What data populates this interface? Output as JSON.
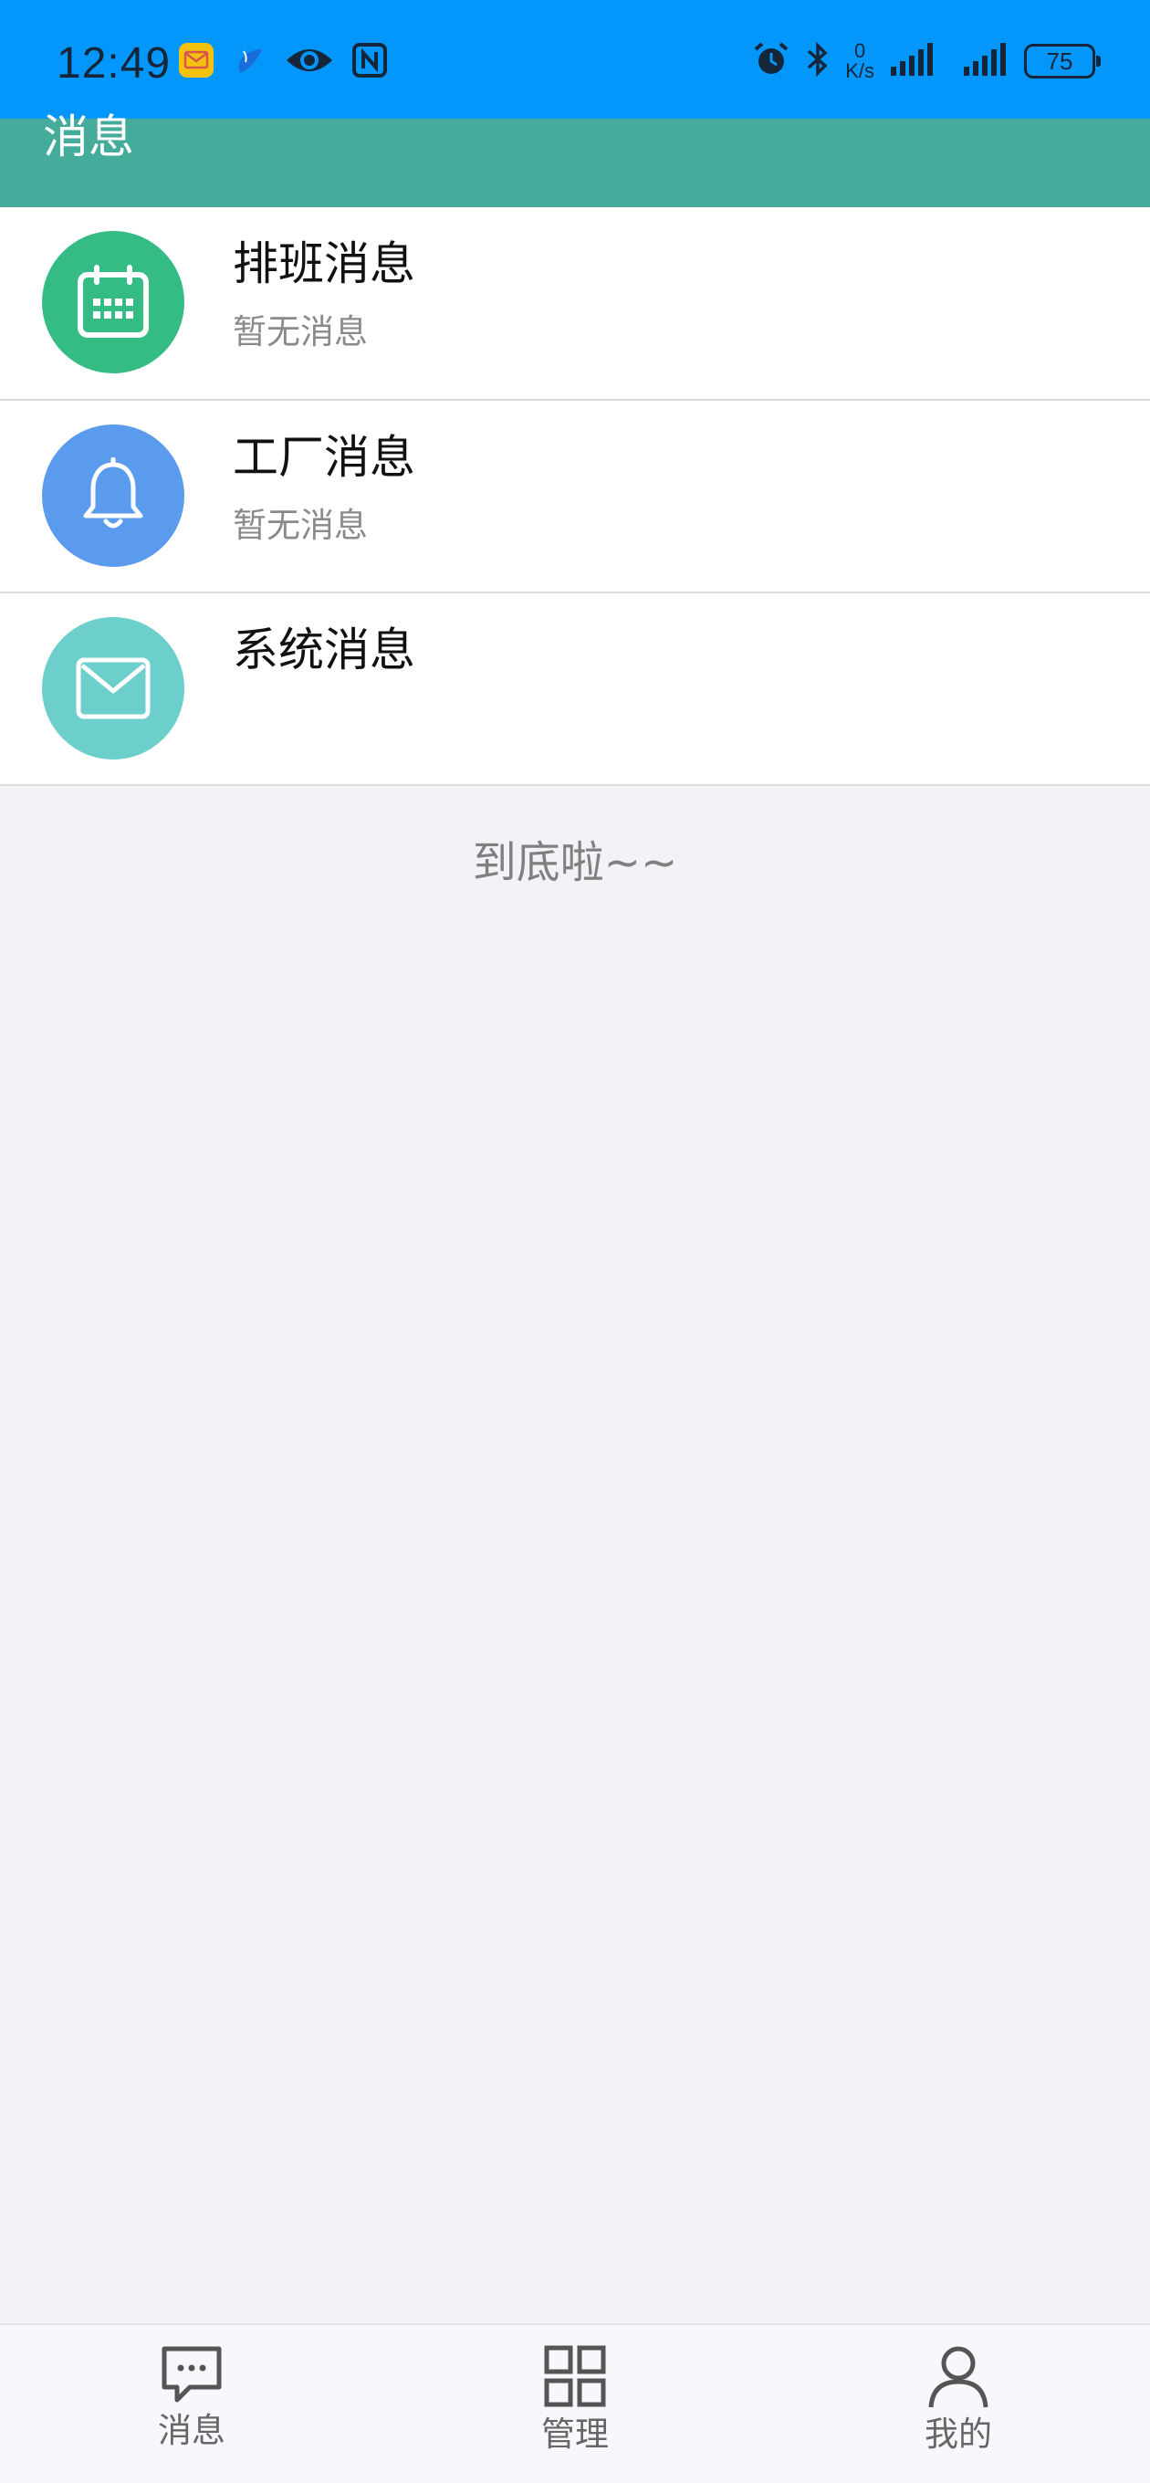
{
  "status_bar": {
    "time": "12:49",
    "net_speed_value": "0",
    "net_speed_unit": "K/s",
    "battery": "75",
    "left_icons": [
      "mail-app-icon",
      "feather-app-icon",
      "eye-icon",
      "nfc-icon"
    ],
    "right_icons": [
      "alarm-icon",
      "bluetooth-icon",
      "signal-icon",
      "signal-icon",
      "battery-icon"
    ]
  },
  "header": {
    "title": "消息"
  },
  "messages": [
    {
      "title": "排班消息",
      "subtitle": "暂无消息",
      "icon": "calendar-icon",
      "color": "#35bc85"
    },
    {
      "title": "工厂消息",
      "subtitle": "暂无消息",
      "icon": "bell-icon",
      "color": "#5b9bee"
    },
    {
      "title": "系统消息",
      "subtitle": "",
      "icon": "envelope-icon",
      "color": "#6ccfcb"
    }
  ],
  "bottom_note": "到底啦~~",
  "tabbar": {
    "items": [
      {
        "label": "消息",
        "icon": "chat-icon"
      },
      {
        "label": "管理",
        "icon": "grid-icon"
      },
      {
        "label": "我的",
        "icon": "user-icon"
      }
    ]
  }
}
